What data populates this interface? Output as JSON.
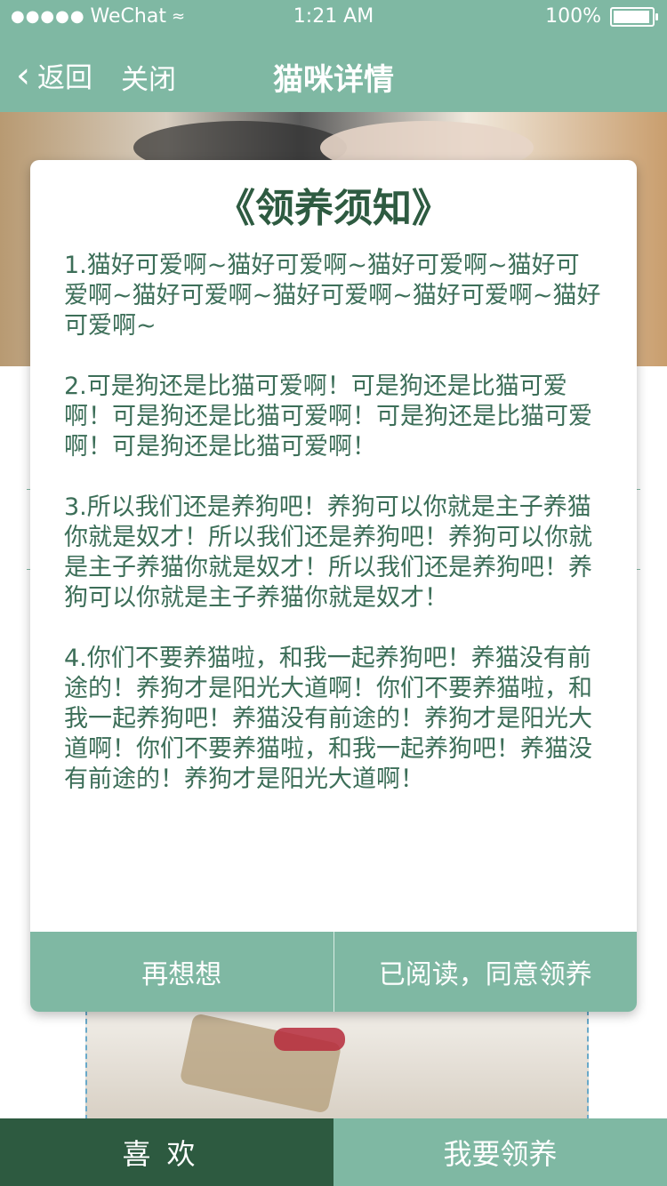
{
  "status": {
    "signal_dots": "●●●●●",
    "carrier": "WeChat",
    "wifi_symbol": "≈",
    "time": "1:21 AM",
    "battery": "100%"
  },
  "nav": {
    "back_label": "返回",
    "close_label": "关闭",
    "title": "猫咪详情"
  },
  "modal": {
    "title": "《领养须知》",
    "body": "1.猫好可爱啊~猫好可爱啊~猫好可爱啊~猫好可爱啊~猫好可爱啊~猫好可爱啊~猫好可爱啊~猫好可爱啊~\n\n2.可是狗还是比猫可爱啊！可是狗还是比猫可爱啊！可是狗还是比猫可爱啊！可是狗还是比猫可爱啊！可是狗还是比猫可爱啊！\n\n3.所以我们还是养狗吧！养狗可以你就是主子养猫你就是奴才！所以我们还是养狗吧！养狗可以你就是主子养猫你就是奴才！所以我们还是养狗吧！养狗可以你就是主子养猫你就是奴才！\n\n4.你们不要养猫啦，和我一起养狗吧！养猫没有前途的！养狗才是阳光大道啊！你们不要养猫啦，和我一起养狗吧！养猫没有前途的！养狗才是阳光大道啊！你们不要养猫啦，和我一起养狗吧！养猫没有前途的！养狗才是阳光大道啊！",
    "cancel_label": "再想想",
    "confirm_label": "已阅读，同意领养"
  },
  "bottom": {
    "like_label": "喜欢",
    "adopt_label": "我要领养"
  },
  "colors": {
    "primary": "#7fb8a3",
    "dark": "#2d5a40",
    "text": "#3c6e58"
  }
}
